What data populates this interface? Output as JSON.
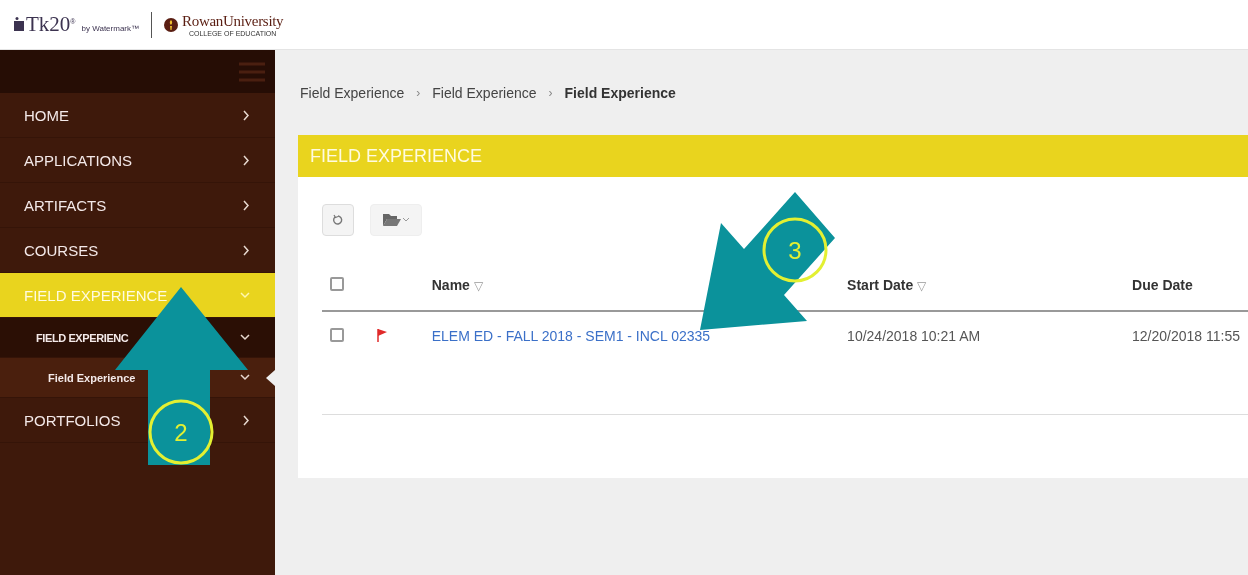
{
  "header": {
    "product_logo": "Tk20",
    "product_mark": "®",
    "product_byline": "by Watermark™",
    "school_name": "RowanUniversity",
    "school_subtitle": "COLLEGE OF EDUCATION"
  },
  "sidebar": {
    "items": [
      {
        "label": "HOME",
        "selected": false,
        "expanded": false
      },
      {
        "label": "APPLICATIONS",
        "selected": false,
        "expanded": false
      },
      {
        "label": "ARTIFACTS",
        "selected": false,
        "expanded": false
      },
      {
        "label": "COURSES",
        "selected": false,
        "expanded": false
      },
      {
        "label": "FIELD EXPERIENCE",
        "selected": true,
        "expanded": true,
        "children": [
          {
            "label": "FIELD EXPERIENC",
            "selected": false,
            "expanded": true,
            "children": [
              {
                "label": "Field Experience",
                "selected": true,
                "expanded": true
              }
            ]
          }
        ]
      },
      {
        "label": "PORTFOLIOS",
        "selected": false,
        "expanded": false
      }
    ]
  },
  "breadcrumb": {
    "separator": "›",
    "items": [
      "Field Experience",
      "Field Experience",
      "Field Experience"
    ]
  },
  "panel": {
    "title": "FIELD EXPERIENCE",
    "columns": [
      {
        "kind": "checkbox",
        "checked": false
      },
      {
        "kind": "flag"
      },
      {
        "kind": "text",
        "label": "Name",
        "sort": "▽"
      },
      {
        "kind": "text",
        "label": "Start Date",
        "sort": "▽"
      },
      {
        "kind": "text",
        "label": "Due Date"
      }
    ],
    "rows": [
      {
        "checked": false,
        "flagged": true,
        "name": "ELEM ED - FALL 2018 - SEM1 - INCL 02335",
        "start_date": "10/24/2018 10:21 AM",
        "due_date": "12/20/2018 11:55"
      }
    ]
  },
  "annotations": [
    {
      "kind": "up",
      "number": "2"
    },
    {
      "kind": "down-left",
      "number": "3"
    }
  ]
}
